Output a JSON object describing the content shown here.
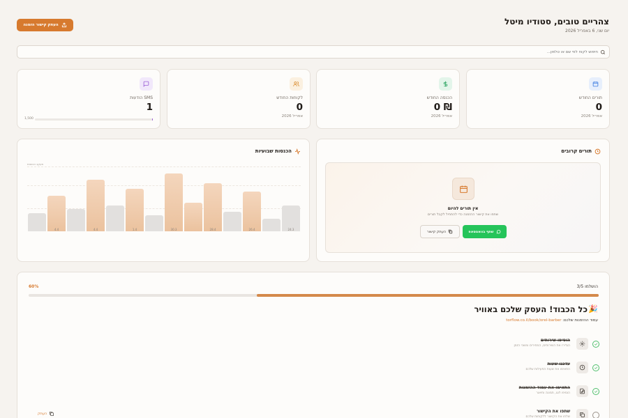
{
  "header": {
    "title": "צהריים טובים, סטודיו מיטל",
    "date": "יום שני, 6 באפריל 2026",
    "copy_button": "העתק קישור הזמנה"
  },
  "search": {
    "placeholder": "חיפוש לקוח לפי שם או טלפון..."
  },
  "stats": [
    {
      "label": "תורים החודש",
      "value": "0",
      "sub": "אפריל 2026",
      "icon": "calendar-icon",
      "color": "#3b7be0",
      "bg": "#e7effc"
    },
    {
      "label": "הכנסה החודש",
      "value": "0 ₪",
      "sub": "אפריל 2026",
      "icon": "dollar-icon",
      "color": "#23a05b",
      "bg": "#e3f5ea"
    },
    {
      "label": "לקוחות החודש",
      "value": "0",
      "sub": "אפריל 2026",
      "icon": "users-icon",
      "color": "#d98a2b",
      "bg": "#fbf0e0"
    },
    {
      "label": "הודעות SMS",
      "value": "1",
      "sub": "1,500",
      "icon": "message-icon",
      "color": "#9b5fd6",
      "bg": "#f1e8fb",
      "progress": 0.001
    }
  ],
  "upcoming": {
    "title": "תורים קרובים",
    "empty_title": "אין תורים להיום",
    "empty_sub": "שתפו את קישור ההזמנה כדי להתחיל לקבל תורים",
    "whatsapp_button": "שתף בוואטסאפ",
    "copy_button": "העתק קישור"
  },
  "chart_data": {
    "type": "bar",
    "title": "הכנסות שבועיות",
    "corner_label": "מעקב הכנסות",
    "bars": [
      {
        "value": 24.3,
        "label": "24.3",
        "highlight": false
      },
      {
        "value": 12,
        "label": "",
        "highlight": false
      },
      {
        "value": 37,
        "label": "26.4",
        "highlight": true
      },
      {
        "value": 18,
        "label": "",
        "highlight": false
      },
      {
        "value": 45,
        "label": "28.4",
        "highlight": true
      },
      {
        "value": 27,
        "label": "",
        "highlight": true
      },
      {
        "value": 54,
        "label": "30.3",
        "highlight": true
      },
      {
        "value": 15,
        "label": "",
        "highlight": false
      },
      {
        "value": 40,
        "label": "1.4",
        "highlight": true
      },
      {
        "value": 24,
        "label": "",
        "highlight": false
      },
      {
        "value": 48,
        "label": "4.4",
        "highlight": true
      },
      {
        "value": 21,
        "label": "",
        "highlight": false
      },
      {
        "value": 33,
        "label": "4.4",
        "highlight": true
      },
      {
        "value": 17,
        "label": "",
        "highlight": false
      }
    ],
    "ymax": 60
  },
  "onboarding": {
    "completed": "3/5 הושלמו",
    "percent_label": "60%",
    "progress": 0.6,
    "title": "כל הכבוד! העסק שלכם באוויר",
    "booking_label": "עמוד ההזמנות שלכם:",
    "booking_link": "torflow.co.il/book/orel-barber",
    "copy_label": "העתק",
    "tasks": [
      {
        "title": "הוסיפו שירותים",
        "sub": "הגדירו את השירותים, המחירים ומשכי הזמן",
        "icon": "gear-icon",
        "done": true
      },
      {
        "title": "עדכנו שעות",
        "sub": "התאימו את שעות הפעילות שלכם",
        "icon": "clock-icon",
        "done": true
      },
      {
        "title": "התאימו את עמוד ההזמנות",
        "sub": "הוסיפו לוגו, תמונה ותיאור",
        "icon": "edit-icon",
        "done": true
      },
      {
        "title": "שתפו את הקישור",
        "sub": "שלחו את הקישור ללקוחות שלכם",
        "icon": "copy-icon",
        "done": false
      }
    ]
  }
}
